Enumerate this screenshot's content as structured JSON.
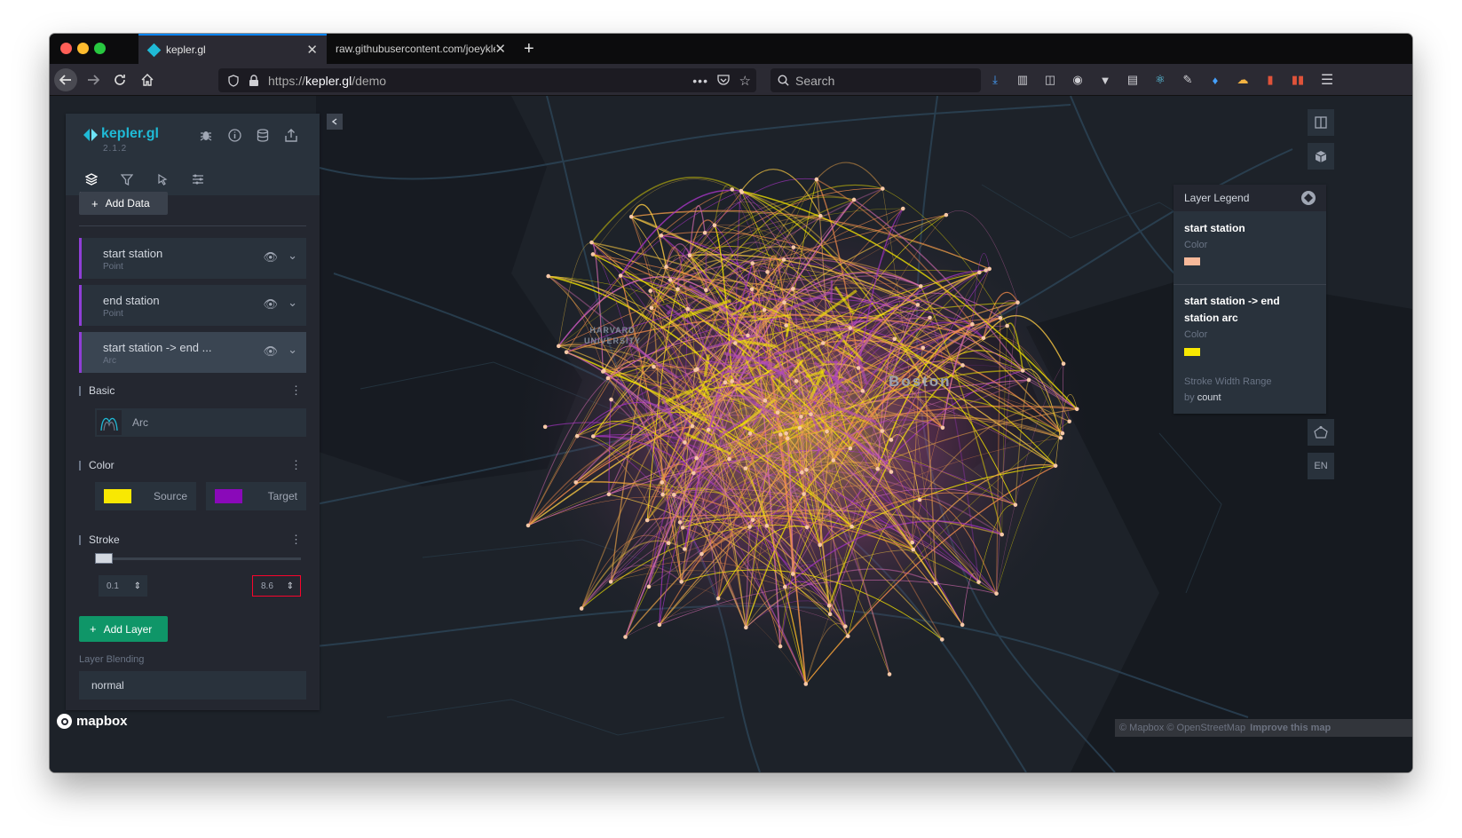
{
  "browser": {
    "tabs": [
      {
        "title": "kepler.gl",
        "active": true
      },
      {
        "title": "raw.githubusercontent.com/joeykle",
        "active": false
      }
    ],
    "url_prefix": "https://",
    "url_domain": "kepler.gl",
    "url_path": "/demo",
    "search_placeholder": "Search",
    "icons": [
      "back-arrow-icon",
      "forward-arrow-icon",
      "reload-icon",
      "home-icon",
      "shield-icon",
      "lock-icon",
      "more-icon",
      "pocket-icon",
      "star-icon",
      "search-icon",
      "download-icon",
      "library-icon",
      "sidebar-icon",
      "account-icon",
      "extension-icon",
      "menu-icon"
    ]
  },
  "app": {
    "name": "kepler.gl",
    "version": "2.1.2",
    "add_data_label": "Add Data",
    "layers": [
      {
        "name": "start station",
        "type": "Point"
      },
      {
        "name": "end station",
        "type": "Point"
      },
      {
        "name": "start station -> end ...",
        "type": "Arc"
      }
    ],
    "config": {
      "basic_title": "Basic",
      "layer_type": "Arc",
      "color_title": "Color",
      "source_label": "Source",
      "target_label": "Target",
      "source_color": "#f8e802",
      "target_color": "#8a09b9",
      "stroke_title": "Stroke",
      "stroke_min": "0.1",
      "stroke_max": "8.6"
    },
    "add_layer_label": "Add Layer",
    "blending_label": "Layer Blending",
    "blending_value": "normal"
  },
  "legend": {
    "title": "Layer Legend",
    "items": [
      {
        "name": "start station",
        "sub": "Color",
        "color": "#f7b99a"
      },
      {
        "name": "start station -> end station arc",
        "sub": "Color",
        "color": "#f8e802"
      }
    ],
    "stroke_label": "Stroke Width Range",
    "by_label": "by",
    "by_field": "count"
  },
  "map": {
    "labels": {
      "harvard": "HARVARD",
      "university": "UNIVERSITY",
      "boston": "Boston"
    },
    "lang": "EN",
    "attribution": "© Mapbox © OpenStreetMap",
    "improve": "Improve this map",
    "mapbox": "mapbox"
  }
}
